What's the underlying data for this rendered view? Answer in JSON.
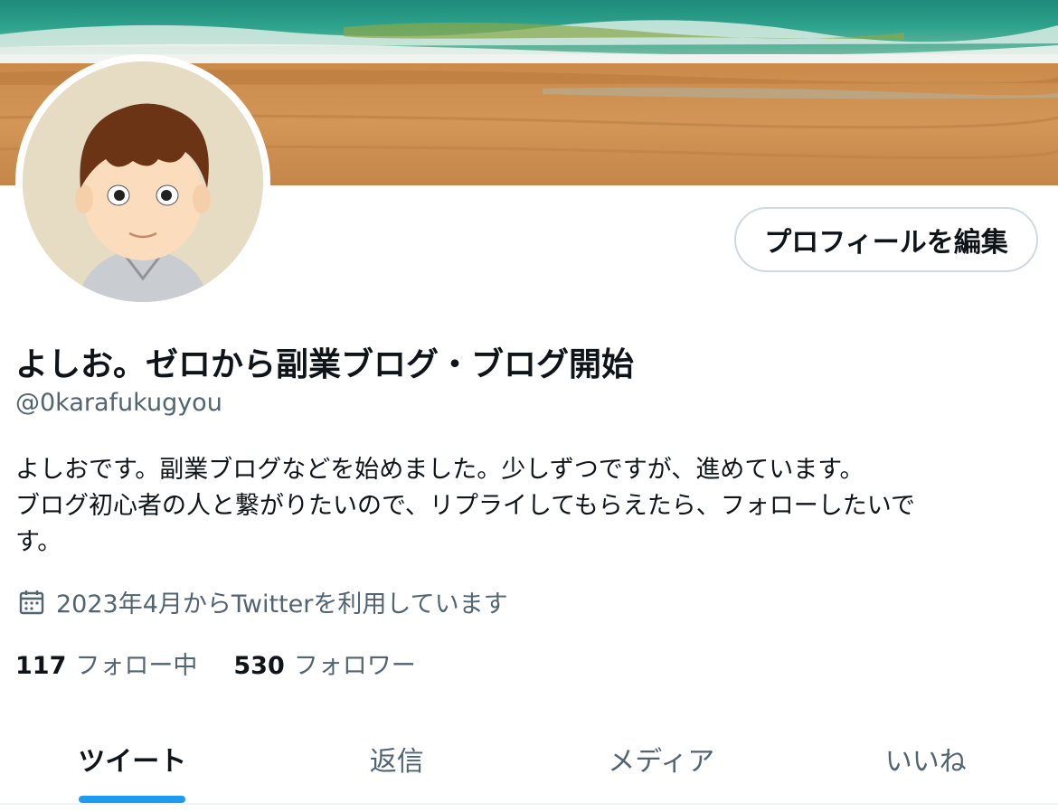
{
  "profile": {
    "display_name": "よしお。ゼロから副業ブログ・ブログ開始",
    "handle": "@0karafukugyou",
    "bio_lines": [
      "よしおです。副業ブログなどを始めました。少しずつですが、進めています。",
      "ブログ初心者の人と繋がりたいので、リプライしてもらえたら、フォローしたいで",
      "す。"
    ],
    "joined": "2023年4月からTwitterを利用しています",
    "joined_icon": "calendar-icon",
    "edit_button": "プロフィールを編集"
  },
  "stats": {
    "following_count": "117",
    "following_label": "フォロー中",
    "followers_count": "530",
    "followers_label": "フォロワー"
  },
  "tabs": [
    {
      "label": "ツイート",
      "active": true
    },
    {
      "label": "返信",
      "active": false
    },
    {
      "label": "メディア",
      "active": false
    },
    {
      "label": "いいね",
      "active": false
    }
  ],
  "colors": {
    "accent": "#1d9bf0",
    "text_primary": "#0f1419",
    "text_secondary": "#536471"
  }
}
